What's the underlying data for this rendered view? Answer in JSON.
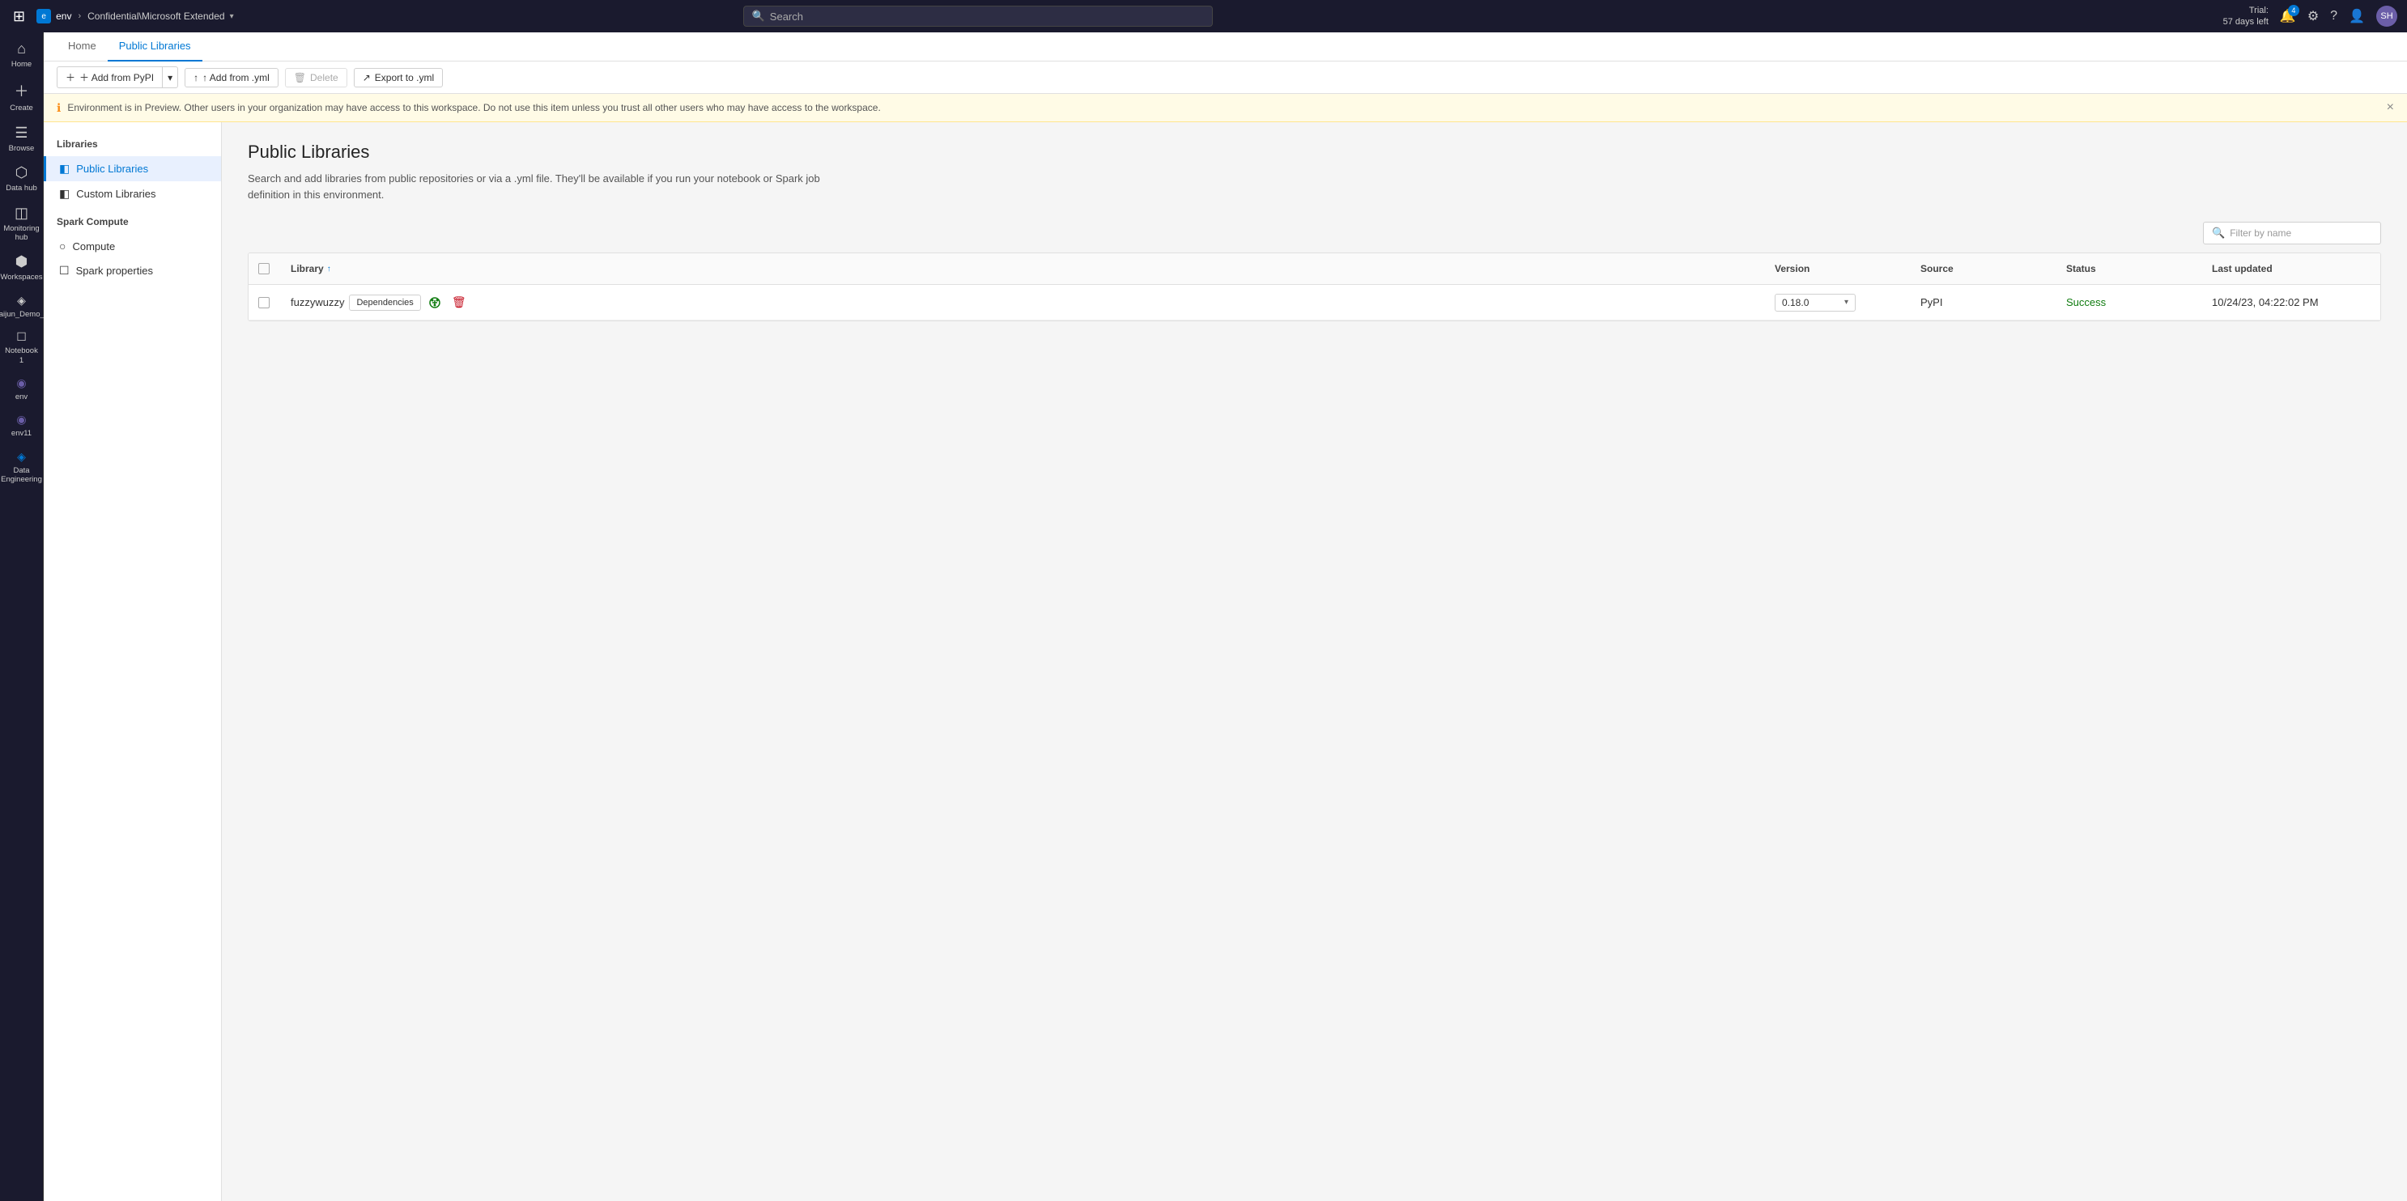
{
  "topNav": {
    "gridIcon": "⊞",
    "envLabel": "env",
    "brandName": "Confidential\\Microsoft Extended",
    "chevron": "▾",
    "searchPlaceholder": "Search",
    "trial": {
      "line1": "Trial:",
      "line2": "57 days left"
    },
    "notificationCount": "4",
    "avatarInitials": "SH"
  },
  "leftRail": [
    {
      "id": "home",
      "icon": "⌂",
      "label": "Home"
    },
    {
      "id": "create",
      "icon": "＋",
      "label": "Create"
    },
    {
      "id": "browse",
      "icon": "☰",
      "label": "Browse"
    },
    {
      "id": "datahub",
      "icon": "⬡",
      "label": "Data hub"
    },
    {
      "id": "monitoring",
      "icon": "◫",
      "label": "Monitoring hub"
    },
    {
      "id": "workspaces",
      "icon": "⬢",
      "label": "Workspaces"
    },
    {
      "id": "shuaijun",
      "icon": "◈",
      "label": "Shuaijun_Demo_Env"
    },
    {
      "id": "notebook1",
      "icon": "☐",
      "label": "Notebook 1"
    },
    {
      "id": "env",
      "icon": "◉",
      "label": "env"
    },
    {
      "id": "env11",
      "icon": "◉",
      "label": "env11"
    },
    {
      "id": "dataeng",
      "icon": "◈",
      "label": "Data Engineering"
    }
  ],
  "tabs": [
    {
      "id": "home",
      "label": "Home"
    },
    {
      "id": "public-libraries",
      "label": "Public Libraries",
      "active": true
    }
  ],
  "toolbar": {
    "addFromPyPI": "＋ Add from PyPI",
    "addFromPyPIChevron": "▾",
    "addFromYml": "↑ Add from .yml",
    "delete": "Delete",
    "exportToYml": "Export to .yml"
  },
  "warningBanner": {
    "icon": "ℹ",
    "text": "Environment is in Preview. Other users in your organization may have access to this workspace. Do not use this item unless you trust all other users who may have access to the workspace.",
    "closeIcon": "×"
  },
  "leftNav": {
    "librariesTitle": "Libraries",
    "items": [
      {
        "id": "public-libraries",
        "icon": "◧",
        "label": "Public Libraries",
        "active": true
      },
      {
        "id": "custom-libraries",
        "icon": "◧",
        "label": "Custom Libraries"
      }
    ],
    "sparkComputeTitle": "Spark Compute",
    "sparkItems": [
      {
        "id": "compute",
        "icon": "○",
        "label": "Compute"
      },
      {
        "id": "spark-properties",
        "icon": "☐",
        "label": "Spark properties"
      }
    ]
  },
  "page": {
    "title": "Public Libraries",
    "description": "Search and add libraries from public repositories or via a .yml file. They'll be available if you run your notebook or Spark job definition in this environment.",
    "filterPlaceholder": "Filter by name",
    "filterIcon": "🔍",
    "table": {
      "columns": [
        "Library",
        "Version",
        "Source",
        "Status",
        "Last updated"
      ],
      "librarySortIcon": "↑",
      "rows": [
        {
          "id": "fuzzywuzzy",
          "library": "fuzzywuzzy",
          "dependenciesLabel": "Dependencies",
          "version": "0.18.0",
          "source": "PyPI",
          "status": "Success",
          "lastUpdated": "10/24/23, 04:22:02 PM"
        }
      ]
    }
  }
}
